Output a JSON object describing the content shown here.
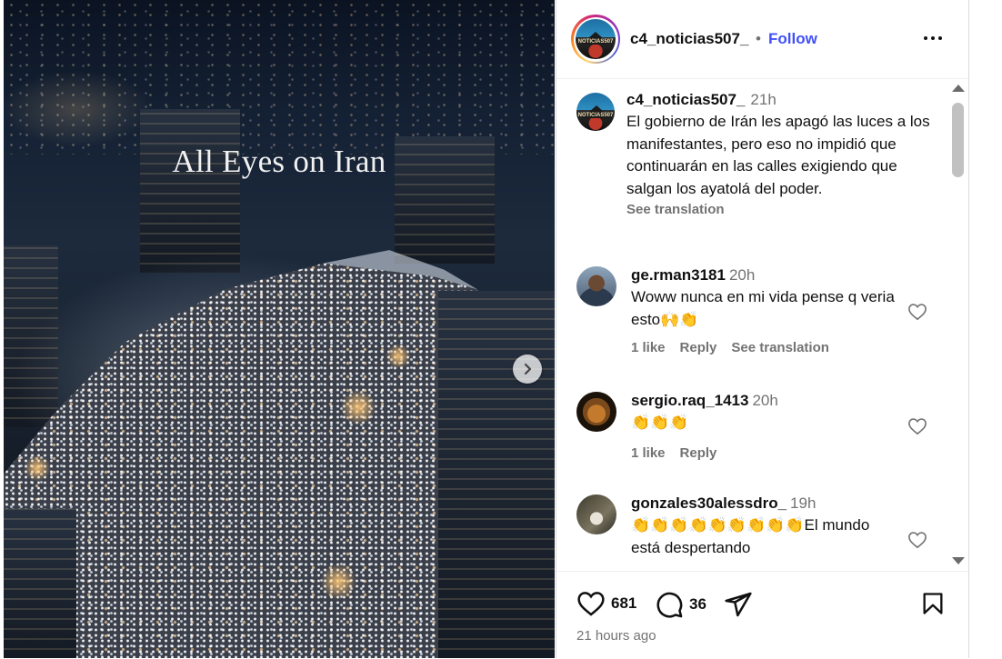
{
  "media": {
    "overlay_text": "All Eyes on Iran"
  },
  "header": {
    "username": "c4_noticias507_",
    "separator": "•",
    "follow_label": "Follow",
    "avatar_label": "NOTICIAS507"
  },
  "caption": {
    "username": "c4_noticias507_",
    "time": "21h",
    "text": "El gobierno de Irán les apagó las luces a los manifestantes, pero eso no impidió que continuarán en las calles exigiendo que salgan los ayatolá del poder.",
    "see_translation": "See translation"
  },
  "comments": [
    {
      "username": "ge.rman3181",
      "time": "20h",
      "text": "Woww nunca en mi vida pense q veria esto🙌👏",
      "likes": "1 like",
      "reply": "Reply",
      "see_translation": "See translation"
    },
    {
      "username": "sergio.raq_1413",
      "time": "20h",
      "text": "👏👏👏",
      "likes": "1 like",
      "reply": "Reply"
    },
    {
      "username": "gonzales30alessdro_",
      "time": "19h",
      "text": "👏👏👏👏👏👏👏👏👏El mundo está despertando"
    }
  ],
  "footer": {
    "like_count": "681",
    "comment_count": "36",
    "time_ago": "21 hours ago"
  },
  "colors": {
    "follow": "#4150f7",
    "secondary_text": "#737373"
  }
}
